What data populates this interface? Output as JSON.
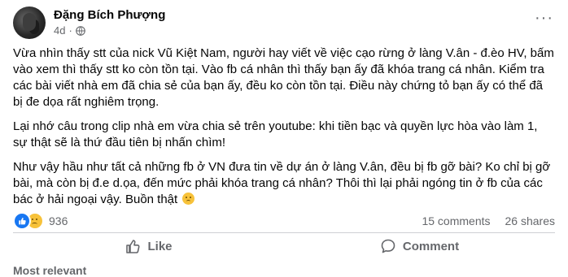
{
  "post": {
    "author": "Đặng Bích Phượng",
    "time": "4d",
    "separator": "·",
    "more_label": "···",
    "paragraphs": [
      "Vừa nhìn thấy stt của nick Vũ Kiệt Nam, người hay viết về việc cạo rừng ở làng V.ân - đ.èo HV, bấm vào xem thì thấy stt ko còn tồn tại. Vào fb cá nhân thì thấy bạn ấy đã khóa trang cá nhân. Kiểm tra các bài viết nhà em đã chia sẻ của bạn ấy, đều ko còn tồn tại. Điều này chứng tỏ bạn ấy có thể đã bị đe dọa rất nghiêm trọng.",
      "Lại nhớ câu trong clip nhà em vừa chia sẻ trên youtube: khi tiền bạc và quyền lực hòa vào làm 1, sự thật sẽ là thứ đầu tiên bị nhấn chìm!",
      "Như vậy hầu như tất cả những fb ở VN đưa tin về dự án ở làng V.ân, đều bị fb gỡ bài? Ko chỉ bị gỡ bài, mà còn bị đ.e d.ọa, đến mức phải khóa trang cá nhân? Thôi thì lại phải ngóng tin ở fb của các bác ở hải ngoại vậy. Buồn thật"
    ],
    "emoji": "sad-face-icon"
  },
  "stats": {
    "reactions": 936,
    "reaction_icons": [
      "like-icon",
      "sad-icon"
    ],
    "comments": "15 comments",
    "shares": "26 shares"
  },
  "actions": {
    "like_label": "Like",
    "comment_label": "Comment"
  },
  "footer": {
    "text": "Most relevant"
  },
  "colors": {
    "like_blue": "#1877f2",
    "secondary_text": "#65676b",
    "divider": "#ced0d4"
  }
}
